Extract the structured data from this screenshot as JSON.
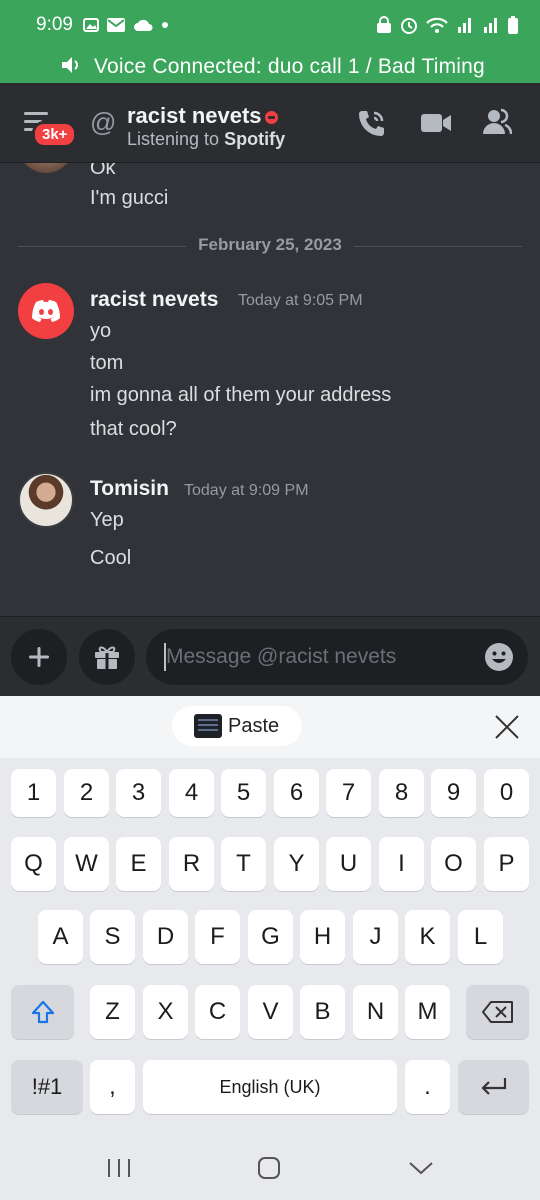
{
  "status_bar": {
    "time": "9:09"
  },
  "voice_banner": {
    "text": "Voice Connected: duo call 1 / Bad Timing"
  },
  "header": {
    "notification_badge": "3k+",
    "username": "racist nevets",
    "activity_prefix": "Listening to",
    "activity_app": "Spotify"
  },
  "messages": {
    "prev_lines": [
      "Ok",
      "I'm gucci"
    ],
    "date_divider": "February 25, 2023",
    "groups": [
      {
        "author": "racist nevets",
        "timestamp": "Today at 9:05 PM",
        "lines": [
          "yo",
          "tom",
          "im gonna all of them your address",
          "that cool?"
        ]
      },
      {
        "author": "Tomisin",
        "timestamp": "Today at 9:09 PM",
        "lines": [
          "Yep",
          "Cool"
        ]
      }
    ]
  },
  "composer": {
    "placeholder": "Message @racist nevets"
  },
  "keyboard": {
    "paste_label": "Paste",
    "row_numbers": [
      "1",
      "2",
      "3",
      "4",
      "5",
      "6",
      "7",
      "8",
      "9",
      "0"
    ],
    "row_q": [
      "Q",
      "W",
      "E",
      "R",
      "T",
      "Y",
      "U",
      "I",
      "O",
      "P"
    ],
    "row_a": [
      "A",
      "S",
      "D",
      "F",
      "G",
      "H",
      "J",
      "K",
      "L"
    ],
    "row_z": [
      "Z",
      "X",
      "C",
      "V",
      "B",
      "N",
      "M"
    ],
    "symbols_key": "!#1",
    "comma_key": ",",
    "space_label": "English (UK)",
    "period_key": "."
  },
  "colors": {
    "banner": "#3ba55c",
    "background": "#313338",
    "accent_red": "#f23f42"
  }
}
